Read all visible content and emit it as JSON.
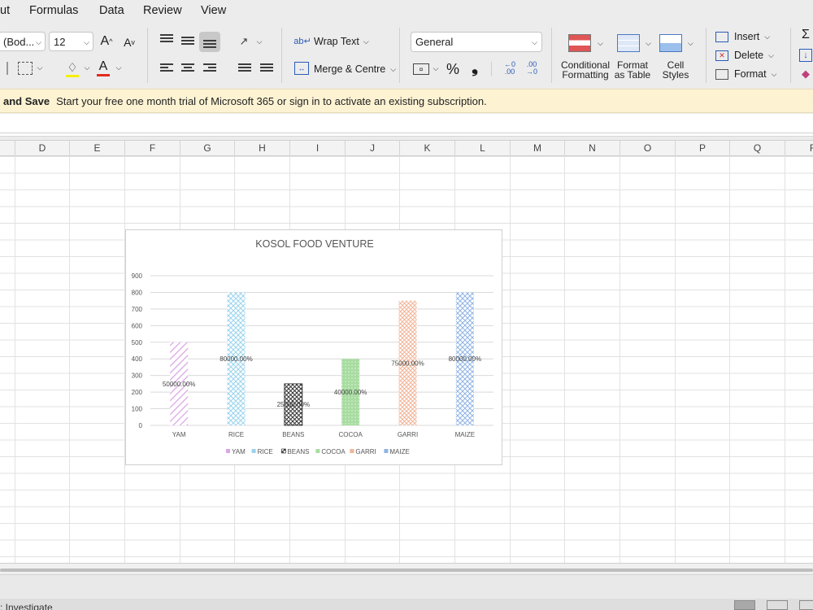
{
  "menu": {
    "tabs": [
      "ut",
      "Formulas",
      "Data",
      "Review",
      "View"
    ]
  },
  "ribbon": {
    "font_name": "(Bod...",
    "font_size": "12",
    "wrap_text_label": "Wrap Text",
    "merge_label": "Merge & Centre",
    "number_format": "General",
    "percent_symbol": "%",
    "comma_symbol": "❟",
    "conditional_formatting_label": [
      "Conditional",
      "Formatting"
    ],
    "format_as_table_label": [
      "Format",
      "as Table"
    ],
    "cell_styles_label": [
      "Cell",
      "Styles"
    ],
    "insert_label": "Insert",
    "delete_label": "Delete",
    "format_label": "Format",
    "grow_font": "A",
    "shrink_font": "A",
    "font_color_letter": "A",
    "increase_decimal": ".00",
    "decrease_decimal": ".00"
  },
  "banner": {
    "bold": "and Save",
    "message": "Start your free one month trial of Microsoft 365 or sign in to activate an existing subscription."
  },
  "grid": {
    "columns": [
      "D",
      "E",
      "F",
      "G",
      "H",
      "I",
      "J",
      "K",
      "L",
      "M",
      "N",
      "O",
      "P",
      "Q",
      "F"
    ]
  },
  "status": {
    "text": ": Investigate"
  },
  "colors": {
    "YAM": "#d9a6e6",
    "RICE": "#9ad3ee",
    "BEANS": "#333333",
    "COCOA": "#a8dca0",
    "GARRI": "#f2b497",
    "MAIZE": "#8fb4e6"
  },
  "chart_data": {
    "type": "bar",
    "title": "KOSOL FOOD VENTURE",
    "categories": [
      "YAM",
      "RICE",
      "BEANS",
      "COCOA",
      "GARRI",
      "MAIZE"
    ],
    "values": [
      500,
      800,
      250,
      400,
      750,
      800
    ],
    "data_labels": [
      "50000.00%",
      "80000.00%",
      "25000.00%",
      "40000.00%",
      "75000.00%",
      "80000.00%"
    ],
    "ylim": [
      0,
      900
    ],
    "yticks": [
      0,
      100,
      200,
      300,
      400,
      500,
      600,
      700,
      800,
      900
    ],
    "grid": true,
    "legend": [
      "YAM",
      "RICE",
      "BEANS",
      "COCOA",
      "GARRI",
      "MAIZE"
    ],
    "legend_position": "bottom"
  }
}
